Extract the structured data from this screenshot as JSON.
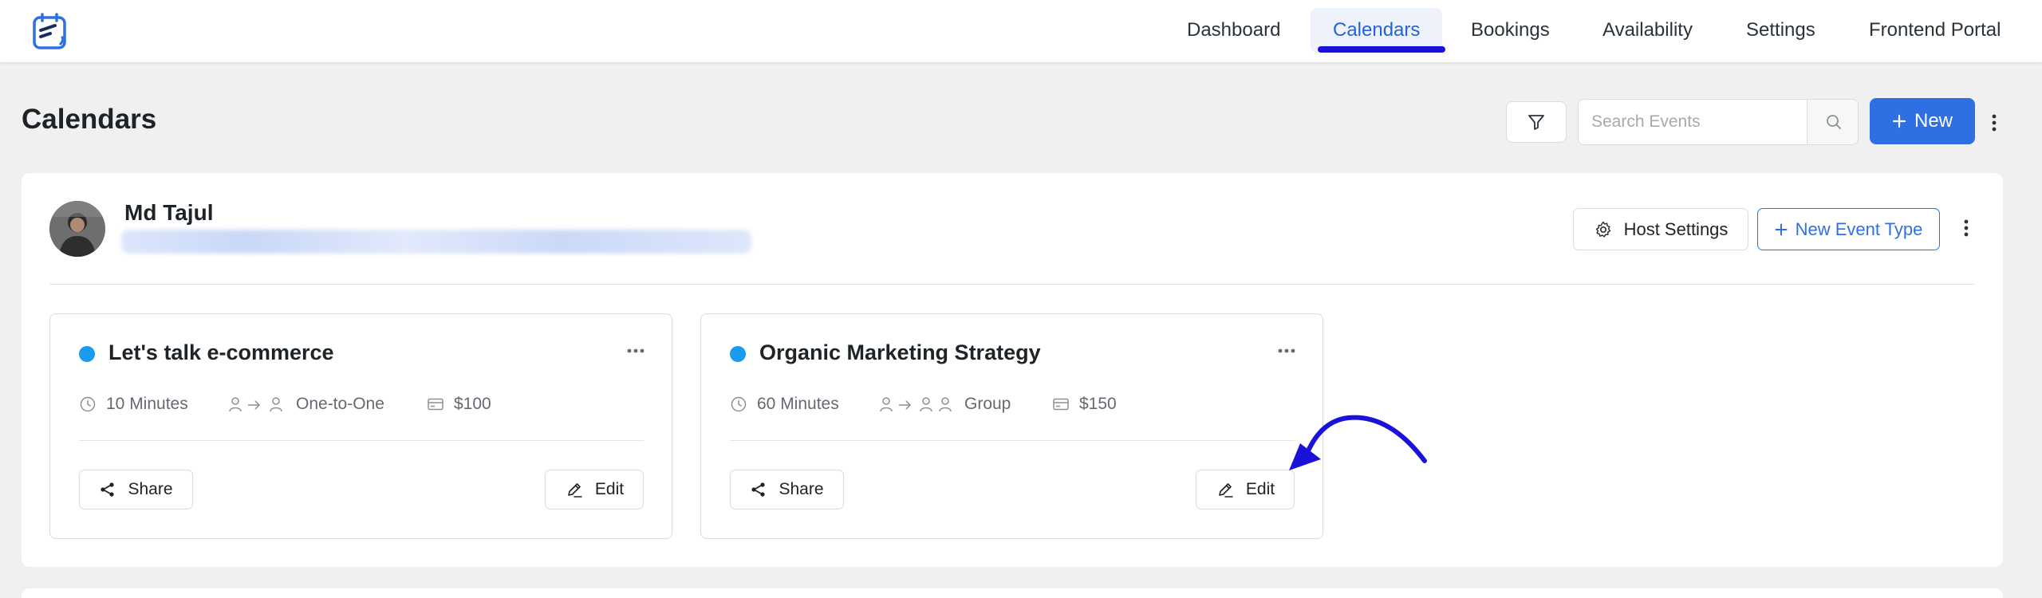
{
  "colors": {
    "accent": "#2f6fe4",
    "nav_underline": "#1b12d9",
    "event_dot": "#1a9bf0",
    "annotation_arrow": "#1b12d9"
  },
  "nav": {
    "logo_icon": "calendar-logo-icon",
    "items": [
      {
        "label": "Dashboard",
        "active": false
      },
      {
        "label": "Calendars",
        "active": true
      },
      {
        "label": "Bookings",
        "active": false
      },
      {
        "label": "Availability",
        "active": false
      },
      {
        "label": "Settings",
        "active": false
      },
      {
        "label": "Frontend Portal",
        "active": false
      }
    ]
  },
  "header": {
    "title": "Calendars",
    "filter_icon": "filter-icon",
    "search": {
      "placeholder": "Search Events",
      "value": "",
      "icon": "search-icon"
    },
    "new_button": {
      "icon": "plus-icon",
      "label": "New"
    },
    "more_icon": "more-vertical-icon"
  },
  "host": {
    "name": "Md Tajul",
    "email": "••••••••••••••••••••••••••••••••••••••••••••",
    "avatar_icon": "avatar",
    "host_settings_button": {
      "icon": "gear-icon",
      "label": "Host Settings"
    },
    "new_event_type_button": {
      "icon": "plus-icon",
      "label": "New Event Type"
    },
    "more_icon": "more-vertical-icon"
  },
  "events": [
    {
      "title": "Let's talk e-commerce",
      "duration": "10 Minutes",
      "type": "One-to-One",
      "price": "$100",
      "share_label": "Share",
      "edit_label": "Edit"
    },
    {
      "title": "Organic Marketing Strategy",
      "duration": "60 Minutes",
      "type": "Group",
      "price": "$150",
      "share_label": "Share",
      "edit_label": "Edit"
    }
  ]
}
